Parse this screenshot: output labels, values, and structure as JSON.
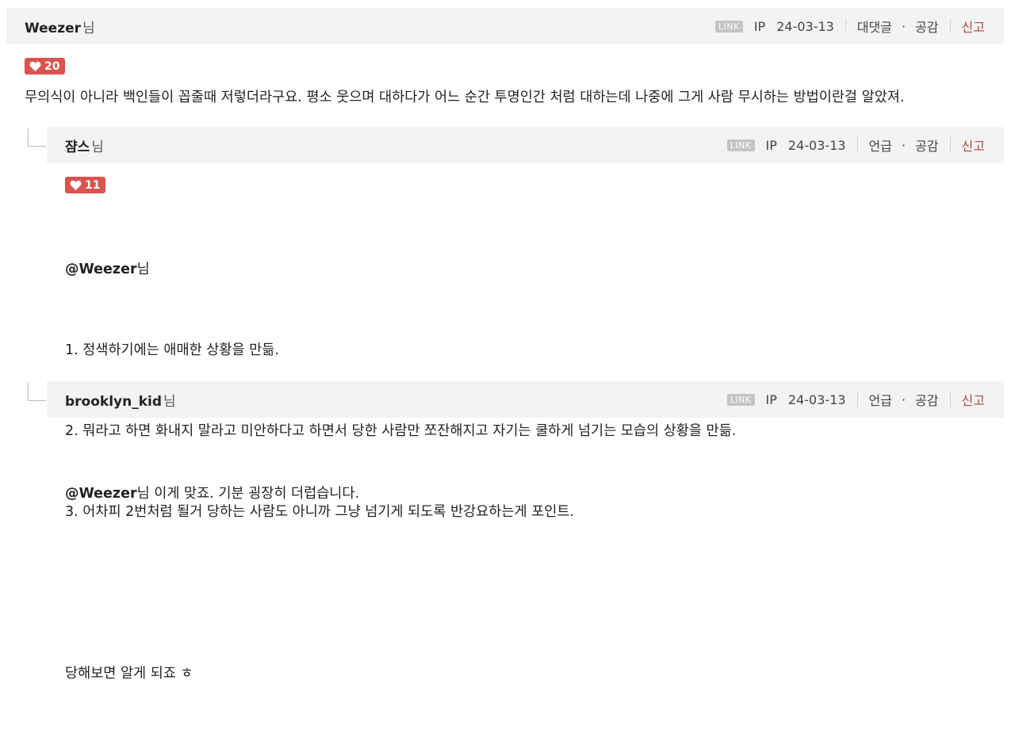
{
  "comments": [
    {
      "author": "Weezer",
      "honorific": "님",
      "link_badge": "LINK",
      "ip_label": "IP",
      "date": "24-03-13",
      "reply_label": "대댓글",
      "empathy_label": "공감",
      "report_label": "신고",
      "likes": "20",
      "lines": [
        "무의식이 아니라 백인들이 꼽줄때 저렇더라구요. 평소 웃으며 대하다가 어느 순간 투명인간 처럼 대하는데 나중에 그게 사람 무시하는 방법이란걸 알았져."
      ]
    },
    {
      "author": "쟘스",
      "honorific": "님",
      "link_badge": "LINK",
      "ip_label": "IP",
      "date": "24-03-13",
      "reply_label": "언급",
      "empathy_label": "공감",
      "report_label": "신고",
      "likes": "11",
      "mention": "@Weezer",
      "mention_suffix": "님",
      "lines": [
        "1. 정색하기에는 애매한 상황을 만듦.",
        "2. 뭐라고 하면 화내지 말라고 미안하다고 하면서 당한 사람만 쪼잔해지고 자기는 쿨하게 넘기는 모습의 상황을 만듦.",
        "3. 어차피 2번처럼 될거 당하는 사람도 아니까 그냥 넘기게 되도록 반강요하는게 포인트.",
        "당해보면 알게 되죠 ㅎ"
      ]
    },
    {
      "author": "brooklyn_kid",
      "honorific": "님",
      "link_badge": "LINK",
      "ip_label": "IP",
      "date": "24-03-13",
      "reply_label": "언급",
      "empathy_label": "공감",
      "report_label": "신고",
      "mention": "@Weezer",
      "mention_suffix": "님",
      "text": " 이게 맞죠. 기분 굉장히 더럽습니다."
    }
  ],
  "colors": {
    "like_badge": "#d9534f",
    "report": "#b0453f",
    "header_bg": "#f3f3f3"
  }
}
